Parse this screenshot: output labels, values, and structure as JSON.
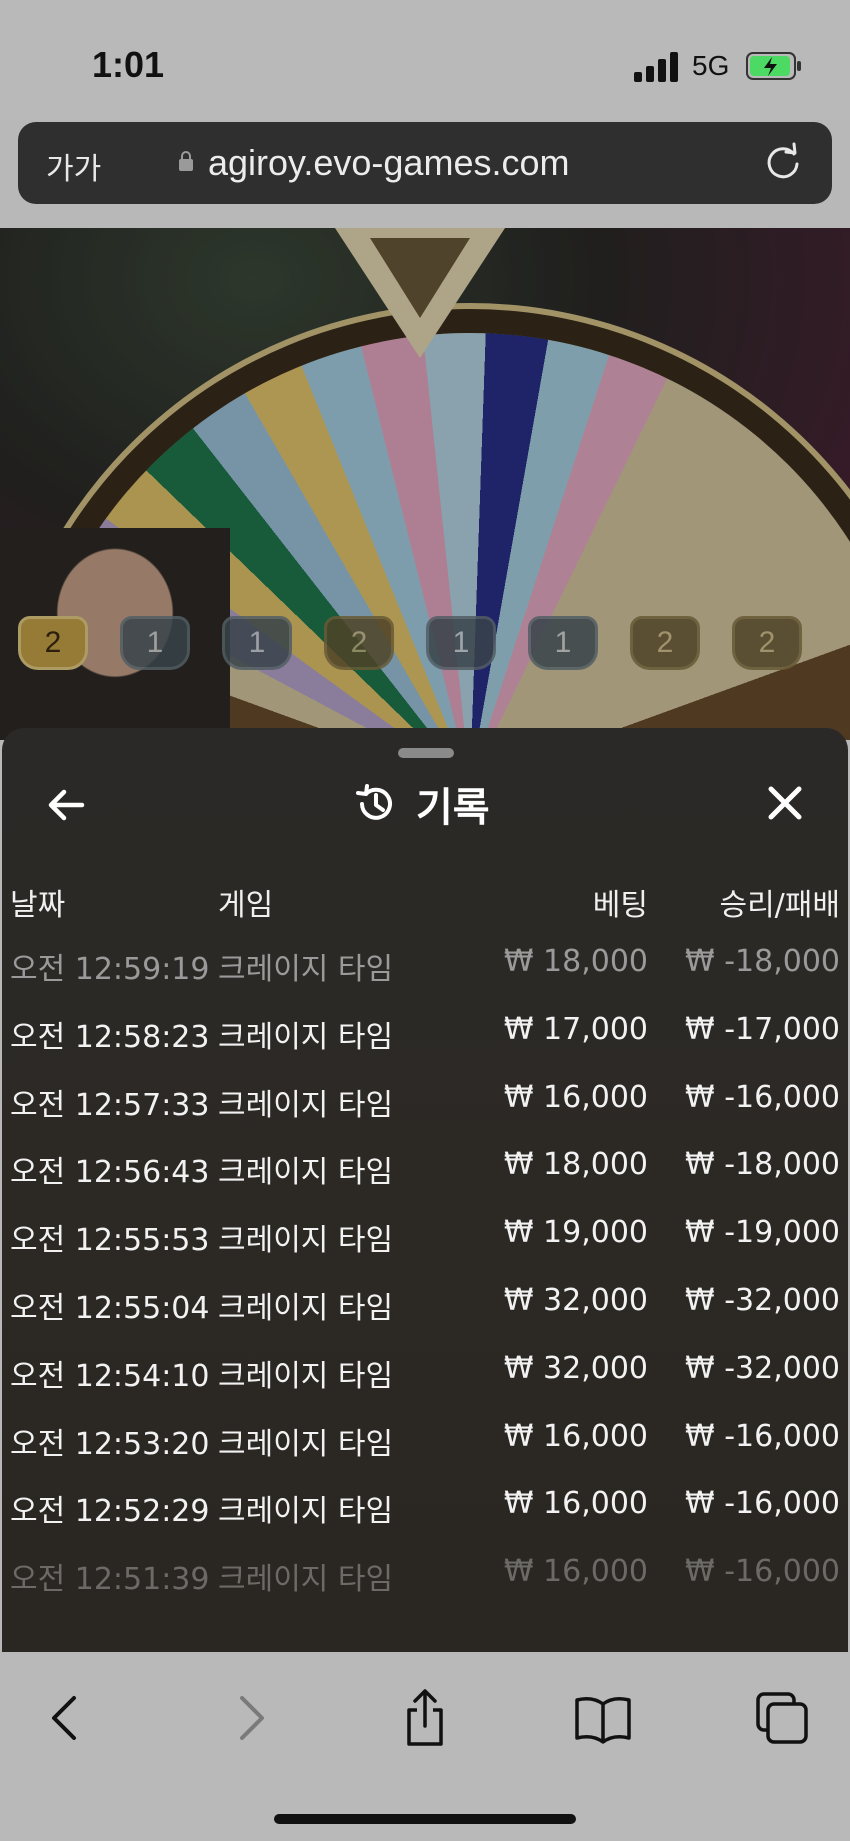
{
  "status_bar": {
    "time": "1:01",
    "network": "5G"
  },
  "browser": {
    "text_size_label": "가가",
    "url": "agiroy.evo-games.com"
  },
  "game": {
    "chips": [
      {
        "value": "2",
        "style": "gold"
      },
      {
        "value": "1",
        "style": "blue"
      },
      {
        "value": "1",
        "style": "blue"
      },
      {
        "value": "2",
        "style": "dgold"
      },
      {
        "value": "1",
        "style": "blue"
      },
      {
        "value": "1",
        "style": "blue"
      },
      {
        "value": "2",
        "style": "dgold"
      },
      {
        "value": "2",
        "style": "dgold"
      }
    ]
  },
  "history": {
    "title": "기록",
    "columns": {
      "date": "날짜",
      "game": "게임",
      "bet": "베팅",
      "result": "승리/패배"
    },
    "rows": [
      {
        "date": "오전 12:59:19",
        "game": "크레이지 타임",
        "bet": "₩ 18,000",
        "result": "₩ -18,000"
      },
      {
        "date": "오전 12:58:23",
        "game": "크레이지 타임",
        "bet": "₩ 17,000",
        "result": "₩ -17,000"
      },
      {
        "date": "오전 12:57:33",
        "game": "크레이지 타임",
        "bet": "₩ 16,000",
        "result": "₩ -16,000"
      },
      {
        "date": "오전 12:56:43",
        "game": "크레이지 타임",
        "bet": "₩ 18,000",
        "result": "₩ -18,000"
      },
      {
        "date": "오전 12:55:53",
        "game": "크레이지 타임",
        "bet": "₩ 19,000",
        "result": "₩ -19,000"
      },
      {
        "date": "오전 12:55:04",
        "game": "크레이지 타임",
        "bet": "₩ 32,000",
        "result": "₩ -32,000"
      },
      {
        "date": "오전 12:54:10",
        "game": "크레이지 타임",
        "bet": "₩ 32,000",
        "result": "₩ -32,000"
      },
      {
        "date": "오전 12:53:20",
        "game": "크레이지 타임",
        "bet": "₩ 16,000",
        "result": "₩ -16,000"
      },
      {
        "date": "오전 12:52:29",
        "game": "크레이지 타임",
        "bet": "₩ 16,000",
        "result": "₩ -16,000"
      },
      {
        "date": "오전 12:51:39",
        "game": "크레이지 타임",
        "bet": "₩ 16,000",
        "result": "₩ -16,000"
      }
    ]
  },
  "toolbar": {
    "icons": [
      "back-icon",
      "forward-icon",
      "share-icon",
      "bookmarks-icon",
      "tabs-icon"
    ]
  },
  "colors": {
    "panel_bg": "#2a2927",
    "text": "#f2f2f2",
    "battery_fill": "#4cd964"
  }
}
